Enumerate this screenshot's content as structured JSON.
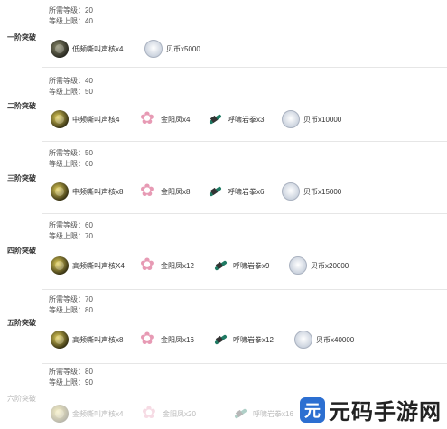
{
  "req_level_label": "所需等级：",
  "cap_level_label": "等级上限：",
  "tiers": [
    {
      "label": "一阶突破",
      "req": "20",
      "cap": "40",
      "mats": [
        {
          "icon": "core-icon",
          "text": "低频嘶叫声核x4"
        },
        {
          "icon": "coin-icon",
          "text": "贝币x5000"
        }
      ]
    },
    {
      "label": "二阶突破",
      "req": "40",
      "cap": "50",
      "mats": [
        {
          "icon": "core-icon",
          "text": "中频嘶叫声核4"
        },
        {
          "icon": "flower-icon",
          "text": "金阳凤x4"
        },
        {
          "icon": "claw-icon",
          "text": "呼啸岩拳x3"
        },
        {
          "icon": "coin-icon",
          "text": "贝币x10000"
        }
      ]
    },
    {
      "label": "三阶突破",
      "req": "50",
      "cap": "60",
      "mats": [
        {
          "icon": "core-icon",
          "text": "中频嘶叫声核x8"
        },
        {
          "icon": "flower-icon",
          "text": "金阳凤x8"
        },
        {
          "icon": "claw-icon",
          "text": "呼啸岩拳x6"
        },
        {
          "icon": "coin-icon",
          "text": "贝币x15000"
        }
      ]
    },
    {
      "label": "四阶突破",
      "req": "60",
      "cap": "70",
      "mats": [
        {
          "icon": "core-icon",
          "text": "高频嘶叫声核X4"
        },
        {
          "icon": "flower-icon",
          "text": "金阳凤x12"
        },
        {
          "icon": "claw-icon",
          "text": "呼啸岩拳x9"
        },
        {
          "icon": "coin-icon",
          "text": "贝币x20000"
        }
      ]
    },
    {
      "label": "五阶突破",
      "req": "70",
      "cap": "80",
      "mats": [
        {
          "icon": "core-icon",
          "text": "高频嘶叫声核x8"
        },
        {
          "icon": "flower-icon",
          "text": "金阳凤x16"
        },
        {
          "icon": "claw-icon",
          "text": "呼啸岩拳x12"
        },
        {
          "icon": "coin-icon",
          "text": "贝币x40000"
        }
      ]
    },
    {
      "label": "六阶突破",
      "req": "80",
      "cap": "90",
      "mats": [
        {
          "icon": "core-icon",
          "text": "金频嘶叫声核x4"
        },
        {
          "icon": "flower-icon",
          "text": "金阳凤x20"
        },
        {
          "icon": "claw-icon",
          "text": "呼啸岩拳x16"
        }
      ]
    }
  ],
  "watermark": {
    "badge": "元",
    "text": "元码手游网"
  }
}
